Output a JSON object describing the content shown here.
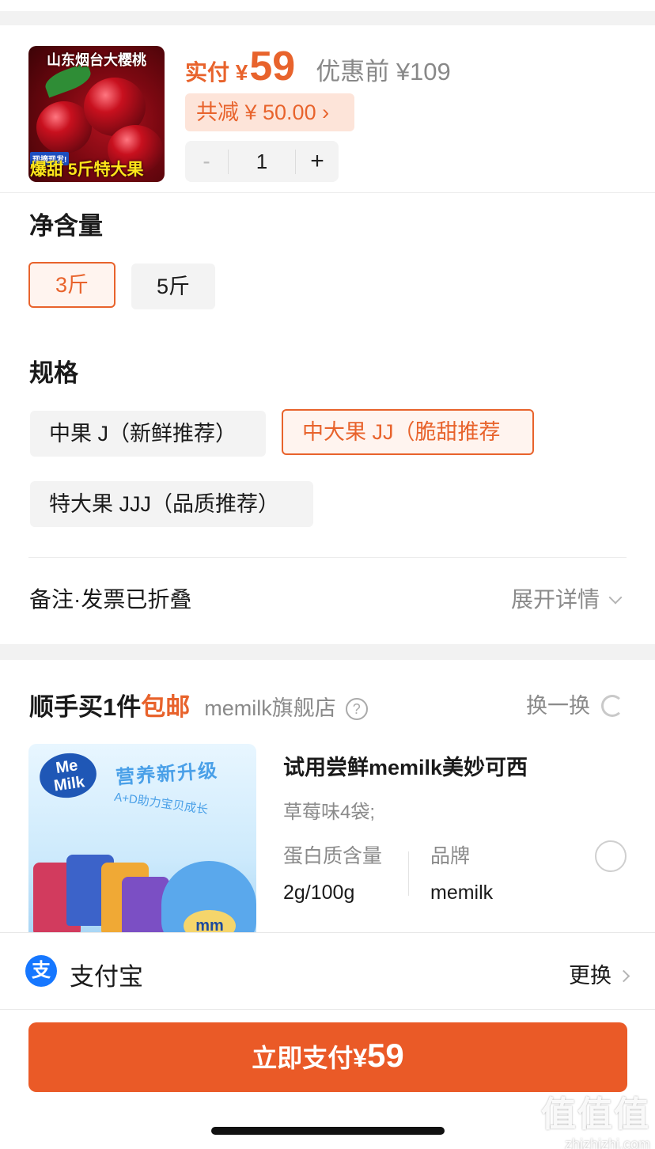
{
  "product": {
    "thumb_text_top": "山东烟台大樱桃",
    "thumb_badge": "现摘现发!",
    "thumb_text_bottom": "爆甜 5斤特大果",
    "price_label": "实付 ¥",
    "price_value": "59",
    "original_price": "优惠前 ¥109",
    "discount_text": "共减 ¥ 50.00 ›",
    "quantity": "1",
    "minus": "-",
    "plus": "+"
  },
  "net_content": {
    "title": "净含量",
    "options": [
      "3斤",
      "5斤"
    ],
    "selected": "3斤"
  },
  "spec": {
    "title": "规格",
    "options": [
      "中果 J（新鲜推荐）",
      "中大果 JJ（脆甜推荐",
      "特大果 JJJ（品质推荐）"
    ],
    "selected": "中大果 JJ（脆甜推荐"
  },
  "note": {
    "label": "备注·发票已折叠",
    "expand": "展开详情"
  },
  "addon": {
    "title_main": "顺手买1件",
    "title_free": "包邮",
    "store": "memilk旗舰店",
    "help_glyph": "?",
    "swap": "换一换",
    "image": {
      "logo": "Me Milk",
      "line1": "营养新升级",
      "line2": "A+D助力宝贝成长",
      "badge": "mm"
    },
    "name": "试用尝鲜memilk美妙可西",
    "flavor": "草莓味4袋;",
    "attrs": [
      {
        "label": "蛋白质含量",
        "value": "2g/100g"
      },
      {
        "label": "品牌",
        "value": "memilk"
      }
    ]
  },
  "payment": {
    "icon_glyph": "支",
    "method": "支付宝",
    "change": "更换"
  },
  "pay_button": {
    "label": "立即支付¥",
    "amount": "59"
  },
  "watermark": {
    "big": "值值值",
    "small": "zhizhizhi.com"
  },
  "colors": {
    "accent": "#e8632c",
    "button": "#ea5a27",
    "alipay": "#1677ff"
  }
}
